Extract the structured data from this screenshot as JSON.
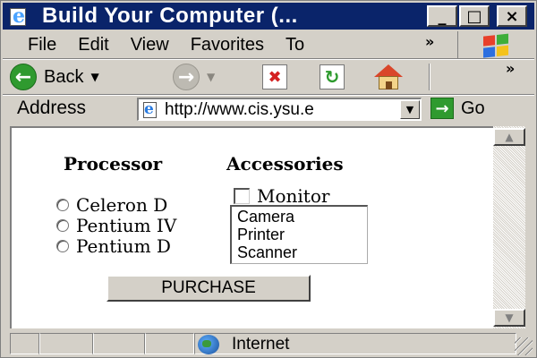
{
  "window": {
    "title": "Build Your Computer (..."
  },
  "title_buttons": {
    "minimize": "_",
    "maximize": "□",
    "close": "×"
  },
  "menu": {
    "items": [
      "File",
      "Edit",
      "View",
      "Favorites",
      "To"
    ],
    "overflow": "»"
  },
  "toolbar": {
    "back_label": "Back",
    "overflow": "»",
    "icons": [
      "back-arrow-icon",
      "forward-arrow-icon",
      "stop-icon",
      "refresh-icon",
      "home-icon"
    ]
  },
  "address": {
    "label": "Address",
    "value": "http://www.cis.ysu.e",
    "go_label": "Go"
  },
  "form": {
    "processor_heading": "Processor",
    "accessories_heading": "Accessories",
    "processors": [
      "Celeron D",
      "Pentium IV",
      "Pentium D"
    ],
    "monitor_label": "Monitor",
    "list_options": [
      "Camera",
      "Printer",
      "Scanner"
    ],
    "purchase_label": "PURCHASE"
  },
  "status": {
    "zone": "Internet"
  },
  "colors": {
    "titlebar": "#0a246a",
    "chrome": "#d4d0c8",
    "content_bg": "#ffffff"
  }
}
